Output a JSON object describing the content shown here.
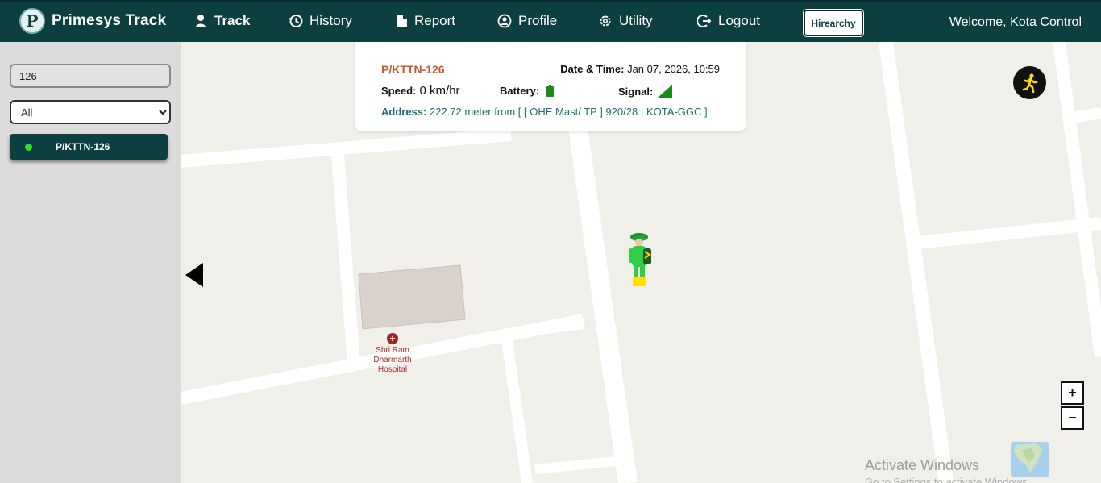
{
  "brand": {
    "name": "Primesys Track",
    "logo_icon": "p-logo-icon"
  },
  "nav": {
    "items": [
      {
        "label": "Track",
        "icon": "person-pin-icon",
        "active": true
      },
      {
        "label": "History",
        "icon": "history-icon",
        "active": false
      },
      {
        "label": "Report",
        "icon": "file-icon",
        "active": false
      },
      {
        "label": "Profile",
        "icon": "user-circle-icon",
        "active": false
      },
      {
        "label": "Utility",
        "icon": "gear-icon",
        "active": false
      },
      {
        "label": "Logout",
        "icon": "logout-icon",
        "active": false
      }
    ],
    "hierarchy_label": "Hirearchy",
    "welcome": "Welcome, Kota Control"
  },
  "sidebar": {
    "search_value": "126",
    "filter": {
      "selected": "All",
      "options": [
        "All"
      ]
    },
    "vehicles": [
      {
        "label": "P/KTTN-126",
        "status_color": "#29e129"
      }
    ]
  },
  "info_card": {
    "vehicle_id": "P/KTTN-126",
    "datetime_label": "Date & Time:",
    "datetime_value": "Jan 07, 2026, 10:59",
    "speed_label": "Speed:",
    "speed_value": "0 km/hr",
    "battery_label": "Battery:",
    "signal_label": "Signal:",
    "address_label": "Address:",
    "address_value": "222.72 meter from [ [ OHE Mast/ TP ] 920/28 ; KOTA-GGC ]"
  },
  "map": {
    "poi_label": "Shri Ram Dharmarth Hospital",
    "zoom_in": "+",
    "zoom_out": "−"
  },
  "watermark": {
    "title": "Activate Windows",
    "subtitle": "Go to Settings to activate Windows."
  },
  "colors": {
    "navbar": "#0c3f3f",
    "vehicle_id": "#c25a2c",
    "address": "#1d6f6f",
    "online": "#29e129"
  }
}
